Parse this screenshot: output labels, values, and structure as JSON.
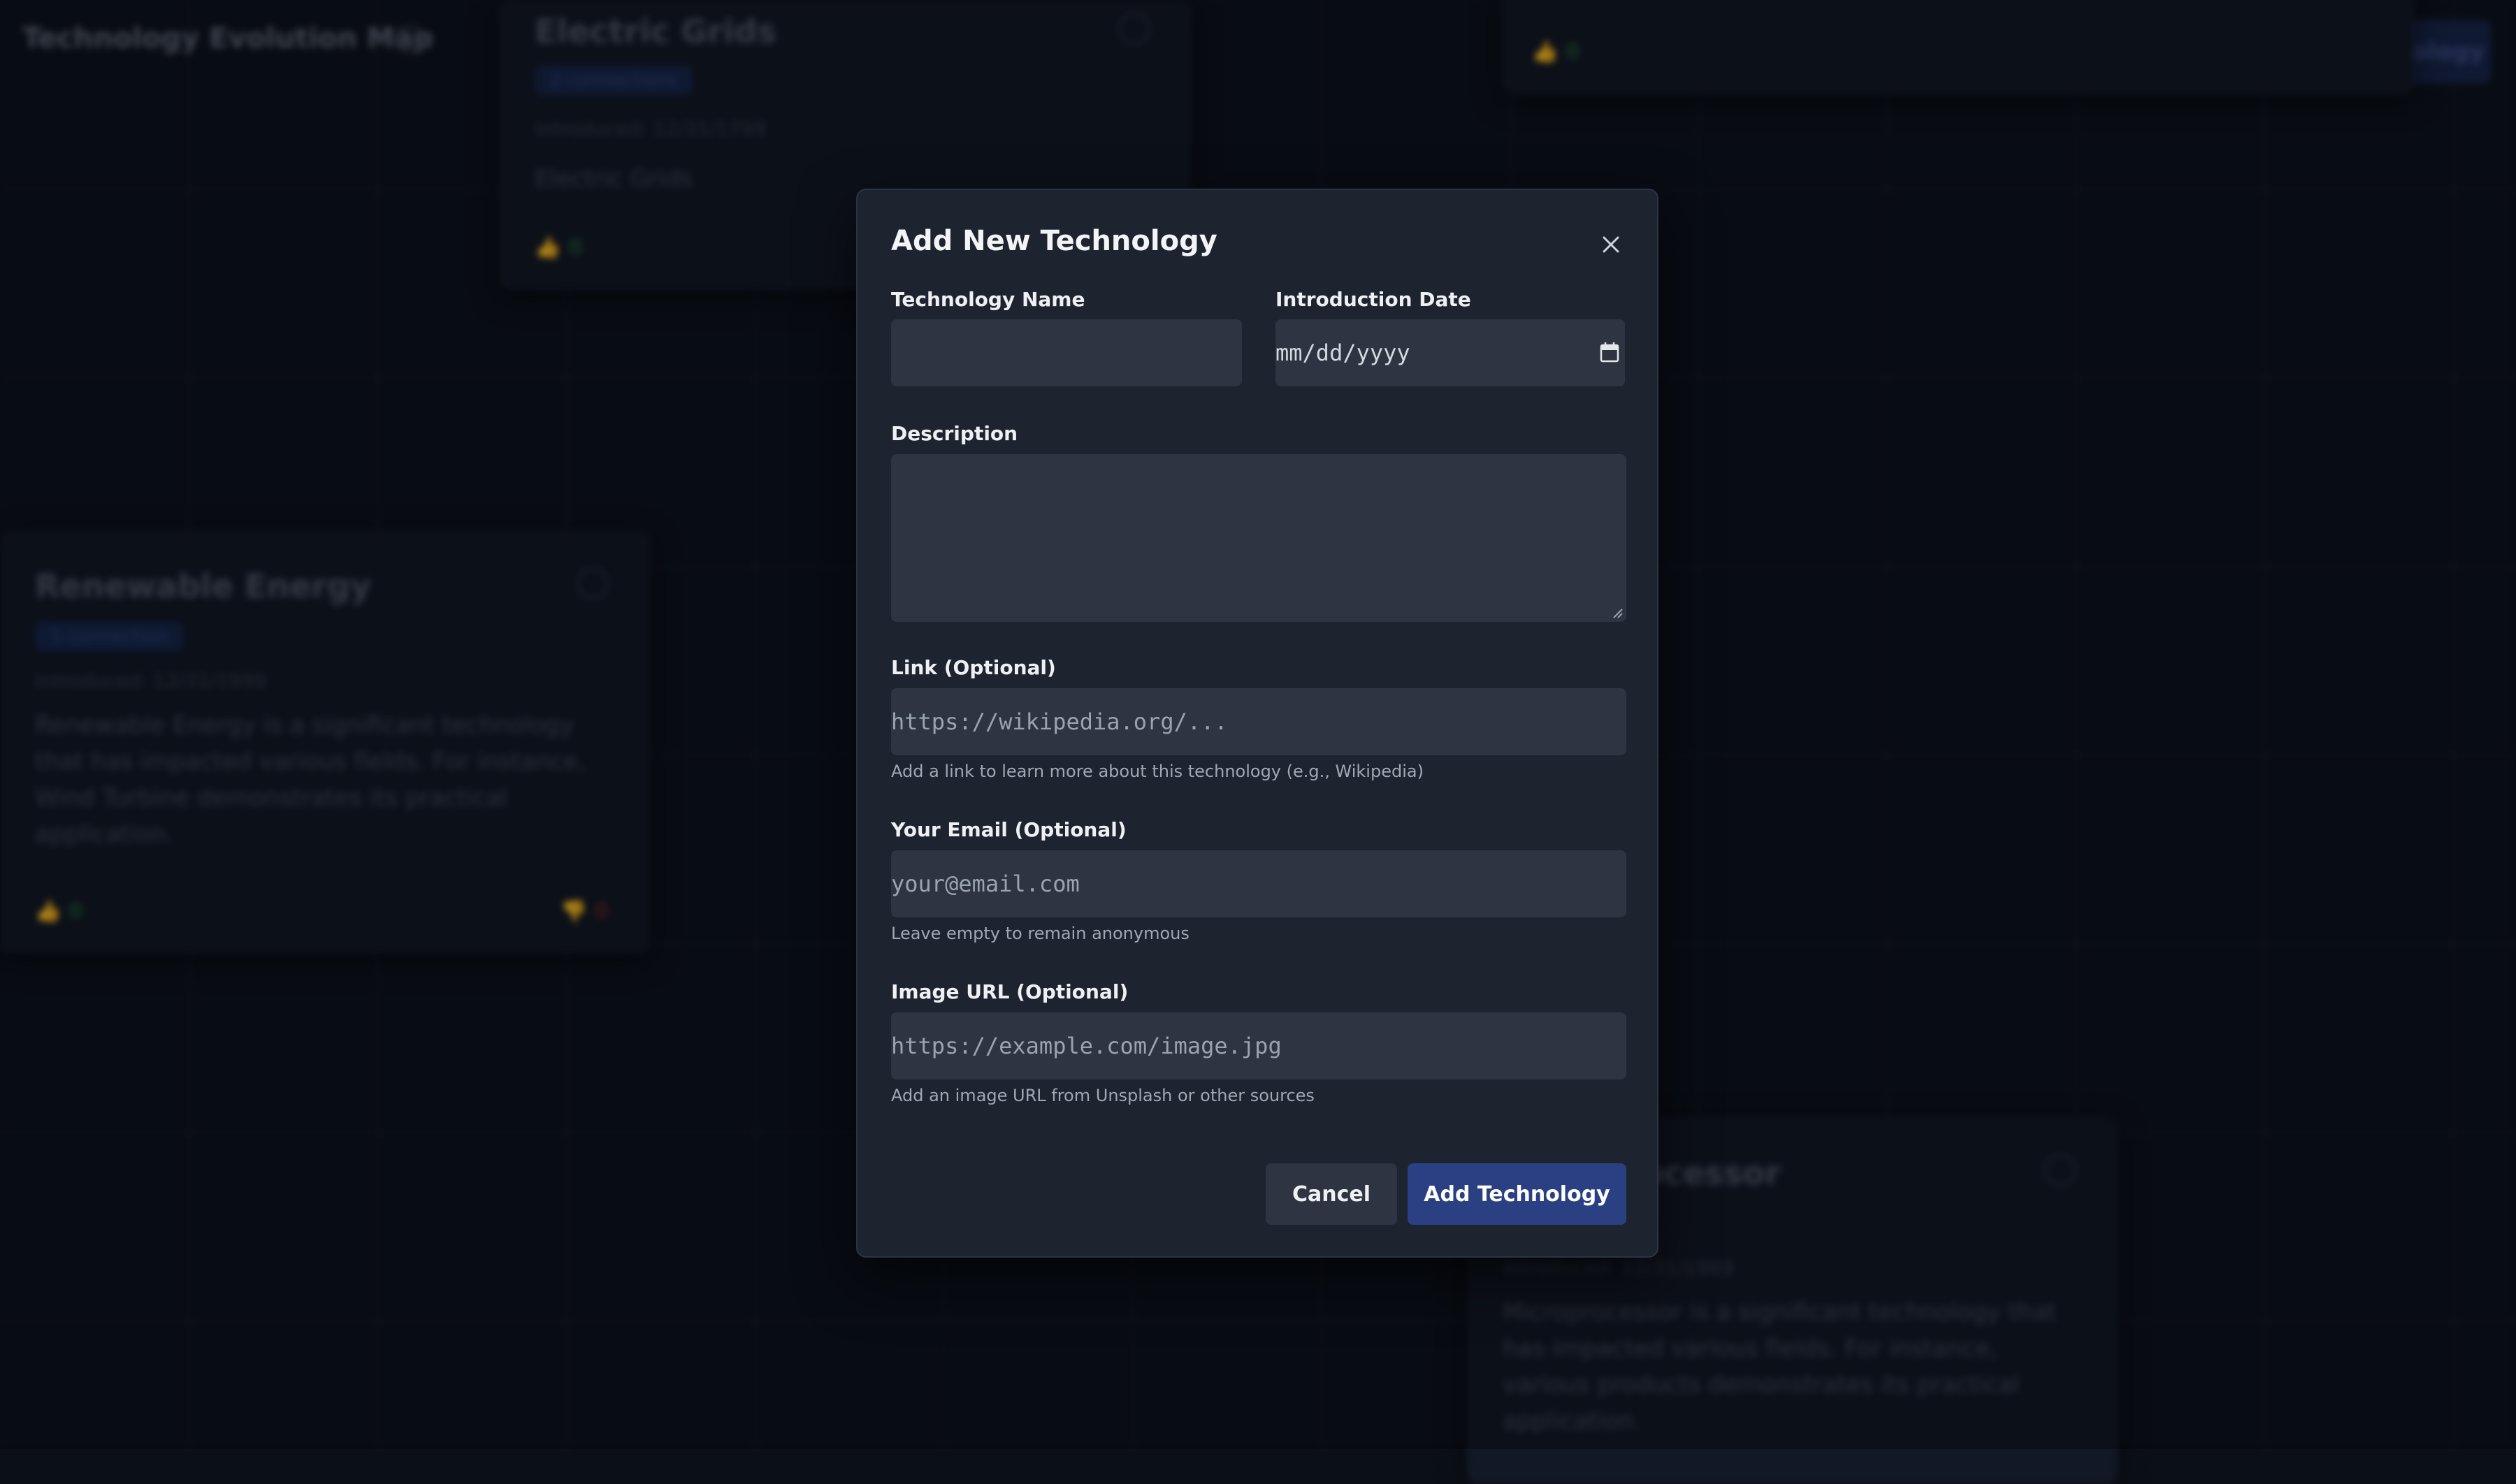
{
  "app": {
    "title": "Technology Evolution Map",
    "add_button_label": "Add Technology"
  },
  "background_cards": [
    {
      "title": "Electric Grids",
      "tag": "2 connections",
      "date": "Introduced: 12/31/1799",
      "description": "Electric Grids",
      "upvotes": "0",
      "downvotes": ""
    },
    {
      "title": "Renewable Energy",
      "tag": "1 connection",
      "date": "Introduced: 12/31/1999",
      "description": "Renewable Energy is a significant technology that has impacted various fields. For instance, Wind Turbine demonstrates its practical application.",
      "upvotes": "0",
      "downvotes": "0"
    },
    {
      "title": "Microprocessor",
      "tag": "",
      "date": "Introduced: 12/31/1969",
      "description": "Microprocessor is a significant technology that has impacted various fields. For instance, various products demonstrates its practical application.",
      "upvotes": "",
      "downvotes": ""
    }
  ],
  "modal": {
    "title": "Add New Technology",
    "fields": {
      "name": {
        "label": "Technology Name",
        "value": "",
        "placeholder": ""
      },
      "date": {
        "label": "Introduction Date",
        "placeholder": "mm/dd/yyyy"
      },
      "description": {
        "label": "Description",
        "value": ""
      },
      "link": {
        "label": "Link (Optional)",
        "placeholder": "https://wikipedia.org/...",
        "help": "Add a link to learn more about this technology (e.g., Wikipedia)"
      },
      "email": {
        "label": "Your Email (Optional)",
        "placeholder": "your@email.com",
        "help": "Leave empty to remain anonymous"
      },
      "image": {
        "label": "Image URL (Optional)",
        "placeholder": "https://example.com/image.jpg",
        "help": "Add an image URL from Unsplash or other sources"
      }
    },
    "cancel_label": "Cancel",
    "submit_label": "Add Technology"
  },
  "colors": {
    "accent": "#2a4083",
    "modal_bg": "#1e2330",
    "input_bg": "#2e3441"
  },
  "icons": {
    "close": "close-icon",
    "calendar": "calendar-icon",
    "plus": "plus-icon",
    "thumbs_up": "thumbs-up-icon",
    "thumbs_down": "thumbs-down-icon"
  }
}
